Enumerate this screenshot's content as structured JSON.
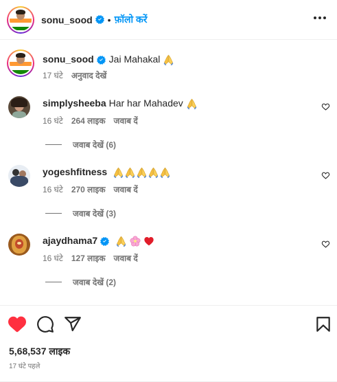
{
  "post_header": {
    "username": "sonu_sood",
    "dot": "•",
    "follow_label": "फ़ॉलो करें"
  },
  "caption": {
    "username": "sonu_sood",
    "text": "Jai Mahakal",
    "time": "17 घंटे",
    "translate_label": "अनुवाद देखें"
  },
  "comments": [
    {
      "username": "simplysheeba",
      "text": "Har har Mahadev",
      "time": "16 घंटे",
      "likes": "264 लाइक",
      "reply_label": "जवाब दें",
      "view_replies": "जवाब देखें (6)"
    },
    {
      "username": "yogeshfitness",
      "text": "",
      "time": "16 घंटे",
      "likes": "270 लाइक",
      "reply_label": "जवाब दें",
      "view_replies": "जवाब देखें (3)"
    },
    {
      "username": "ajaydhama7",
      "text": "",
      "time": "16 घंटे",
      "likes": "127 लाइक",
      "reply_label": "जवाब दें",
      "view_replies": "जवाब देखें (2)"
    }
  ],
  "actions": {
    "like_count": "5,68,537 लाइक",
    "posted_time": "17 घंटे पहले"
  },
  "icons": [
    "verified-icon",
    "more-options-icon",
    "praying-hands-emoji",
    "heart-outline-icon",
    "heart-filled-icon",
    "comment-icon",
    "share-icon",
    "bookmark-icon",
    "flower-emoji",
    "red-heart-emoji"
  ],
  "colors": {
    "accent": "#0095f6",
    "like_red": "#ff3040",
    "muted": "#737373",
    "text": "#262626",
    "verified": "#0095f6"
  }
}
